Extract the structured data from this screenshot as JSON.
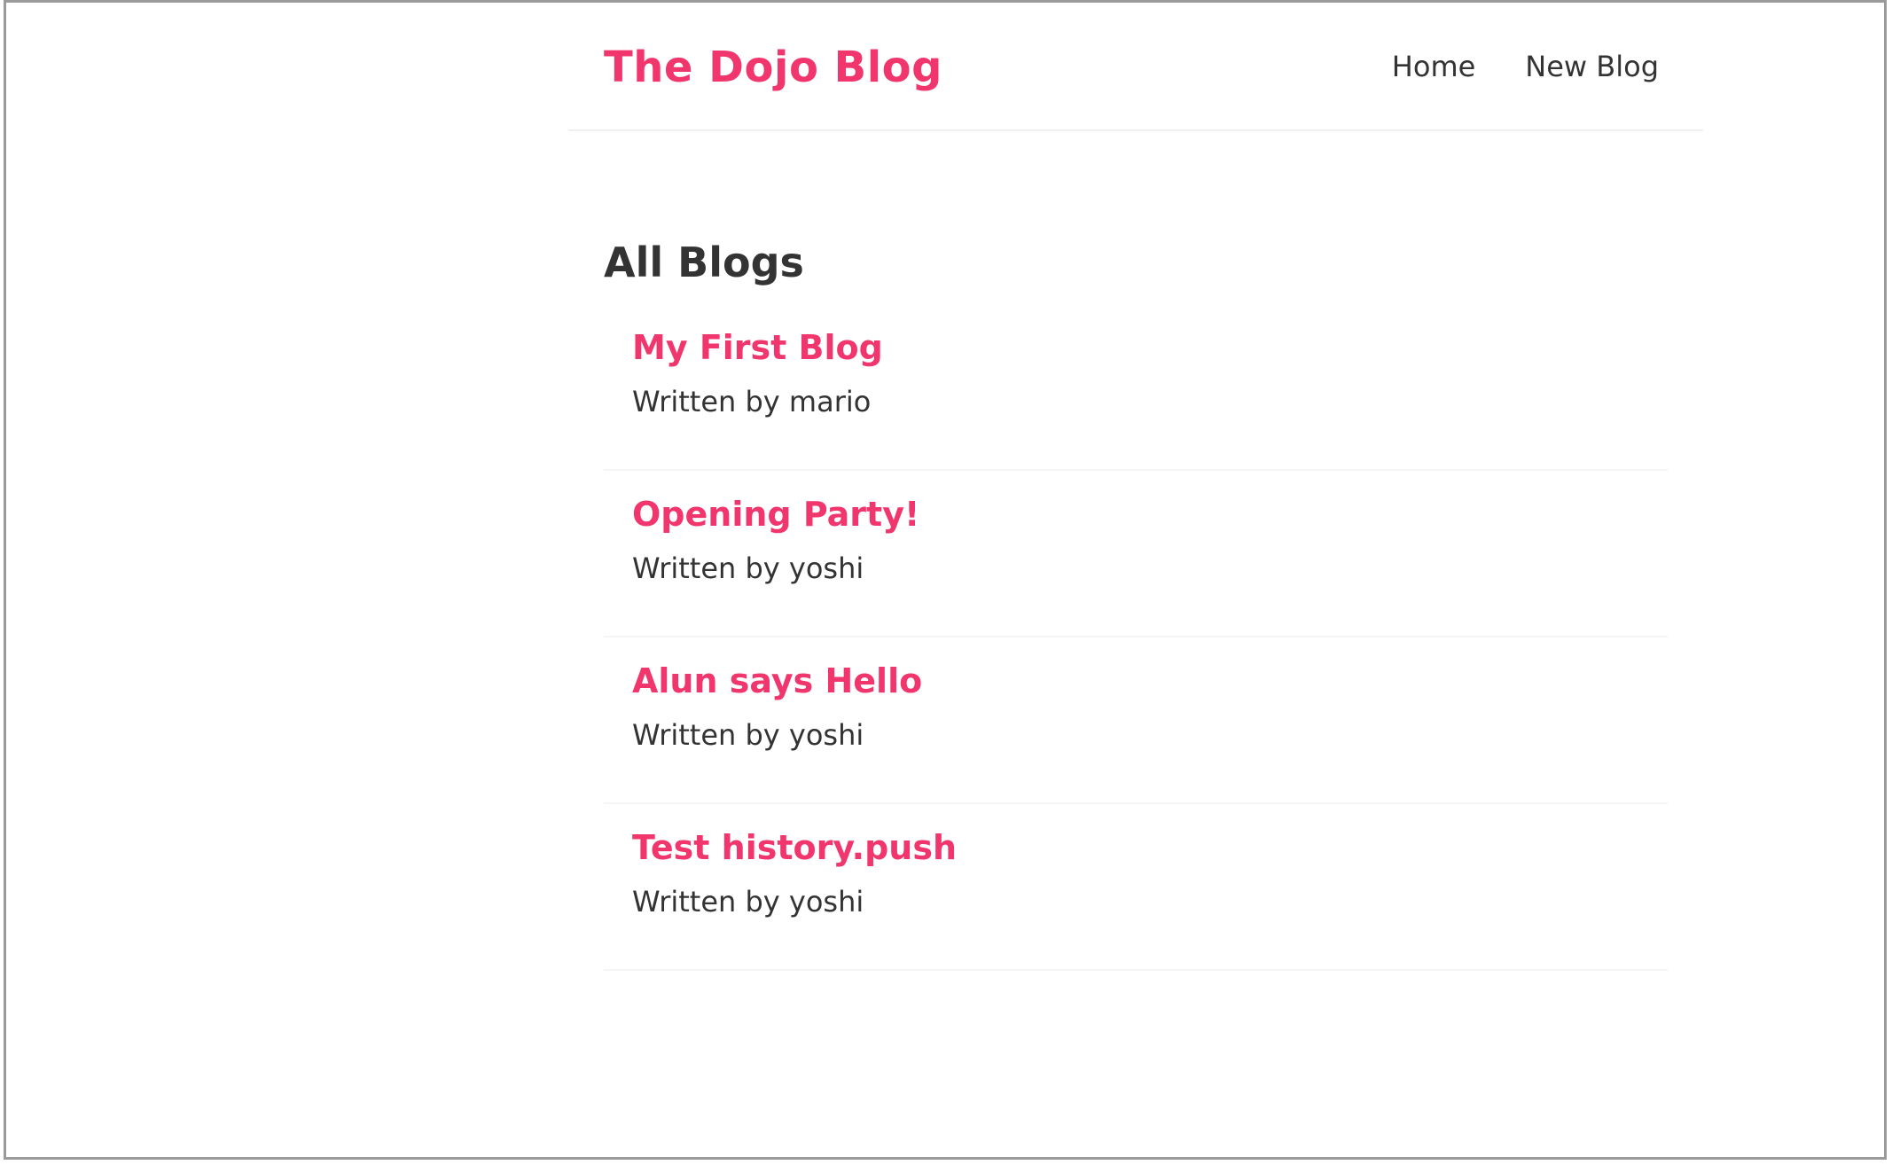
{
  "header": {
    "title": "The Dojo Blog",
    "nav": [
      {
        "label": "Home"
      },
      {
        "label": "New Blog"
      }
    ]
  },
  "main": {
    "title": "All Blogs",
    "blogs": [
      {
        "title": "My First Blog",
        "author_line": "Written by mario"
      },
      {
        "title": "Opening Party!",
        "author_line": "Written by yoshi"
      },
      {
        "title": "Alun says Hello",
        "author_line": "Written by yoshi"
      },
      {
        "title": "Test history.push",
        "author_line": "Written by yoshi"
      }
    ]
  },
  "colors": {
    "brand": "#f1356d",
    "text": "#333333",
    "divider": "#f0f0f0"
  }
}
